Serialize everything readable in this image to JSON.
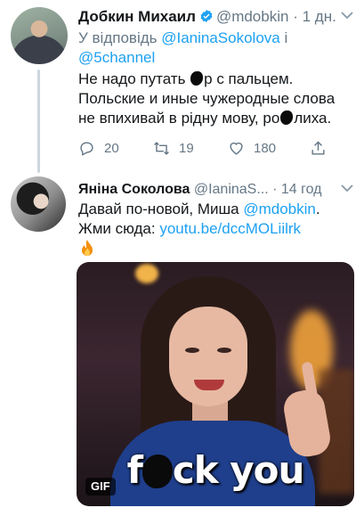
{
  "tweet1": {
    "author_name": "Добкин Михаил",
    "handle": "@mdobkin",
    "separator": "·",
    "time": "1 дн.",
    "reply_prefix": "У відповідь",
    "reply_mention1": "@IaninaSokolova",
    "reply_conj": "і",
    "reply_mention2": "@5channel",
    "text_line1a": "Не надо путать ",
    "text_line1b": "р с пальцем.",
    "text_line2": "Польские и иные чужеродные слова",
    "text_line3a": "не впихивай в рідну мову, ро",
    "text_line3b": "лиха.",
    "replies": "20",
    "retweets": "19",
    "likes": "180"
  },
  "tweet2": {
    "author_name": "Яніна Соколова",
    "handle": "@IaninaS...",
    "separator": "·",
    "time": "14 год",
    "text_line1a": "Давай по-новой, Миша ",
    "text_line1_mention": "@mdobkin",
    "text_line1b": ".",
    "text_line2a": "Жми сюда: ",
    "text_line2_link": "youtu.be/dccMOLiilrk",
    "gif_caption_a": "f",
    "gif_caption_b": "ck you",
    "gif_badge": "GIF"
  },
  "colors": {
    "link": "#1da1f2",
    "secondary": "#657786",
    "verified": "#1da1f2"
  }
}
